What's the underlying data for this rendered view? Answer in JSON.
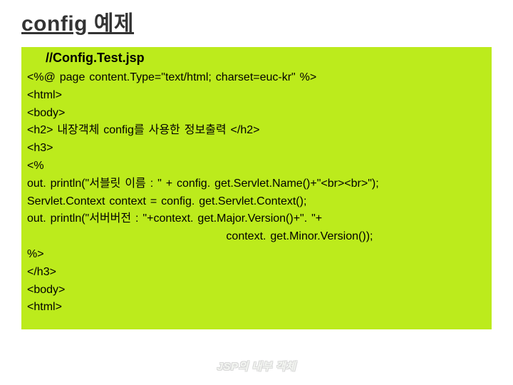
{
  "title": "config 예제",
  "file_label": "//Config.Test.jsp",
  "code_lines": "<%@ page content.Type=\"text/html; charset=euc-kr\" %>\n<html>\n<body>\n<h2> 내장객체 config를 사용한 정보출력 </h2>\n<h3>\n<%\nout. println(\"서블릿 이름 : \" + config. get.Servlet.Name()+\"<br><br>\");\nServlet.Context context = config. get.Servlet.Context();\nout. println(\"서버버전 : \"+context. get.Major.Version()+\". \"+\n                                               context. get.Minor.Version());\n%>\n</h3>\n<body>\n<html>",
  "footer": "JSP의 내부 객체"
}
